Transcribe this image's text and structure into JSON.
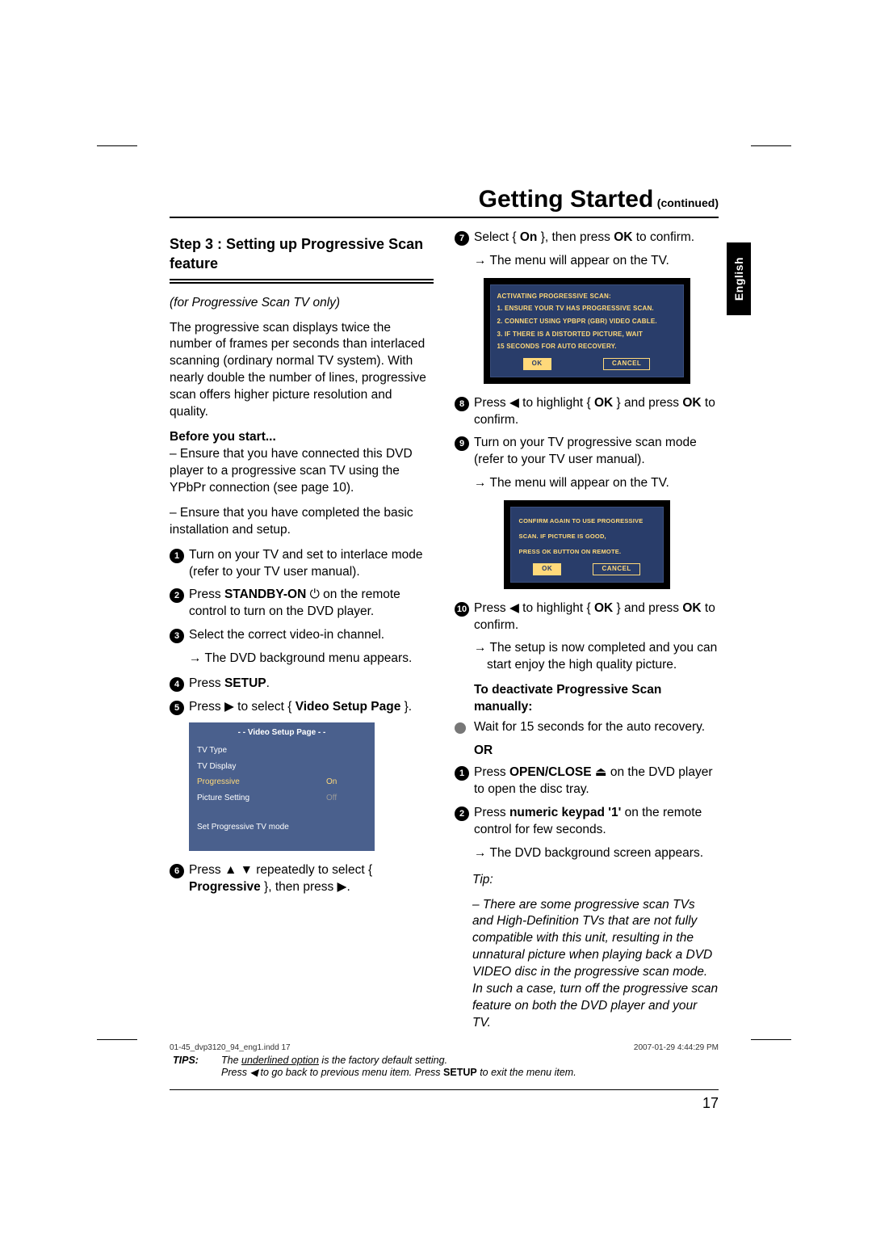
{
  "heading": {
    "title": "Getting Started",
    "continued": "(continued)"
  },
  "lang_tab": "English",
  "subhead": "Step 3 : Setting up Progressive Scan feature",
  "left": {
    "note": "(for Progressive Scan TV only)",
    "intro": "The progressive scan displays twice the number of frames per seconds than interlaced scanning (ordinary normal TV system). With nearly double the number of lines, progressive scan offers higher picture resolution and quality.",
    "before_head": "Before you start...",
    "before_1": "– Ensure that you have connected this DVD player to a progressive scan TV using the YPbPr connection (see page 10).",
    "before_2": "– Ensure that you have completed the basic installation and setup.",
    "s1": "Turn on your TV and set to interlace mode (refer to your TV user manual).",
    "s2_a": "Press ",
    "s2_b": "STANDBY-ON",
    "s2_icon": "⏻",
    "s2_c": " on the remote control to turn on the DVD player.",
    "s3": "Select the correct video-in channel.",
    "s3_arrow": "The DVD background menu appears.",
    "s4_a": "Press ",
    "s4_b": "SETUP",
    "s4_c": ".",
    "s5_a": "Press ",
    "s5_glyph": "▶",
    "s5_b": " to select { ",
    "s5_c": "Video Setup Page",
    "s5_d": " }.",
    "s6_a": "Press ",
    "s6_glyph1": "▲",
    "s6_glyph2": "▼",
    "s6_b": " repeatedly to select { ",
    "s6_c": "Progressive",
    "s6_d": " }, then press ",
    "s6_glyph3": "▶",
    "s6_e": "."
  },
  "osd": {
    "title": "- -   Video Setup Page   - -",
    "r1": "TV Type",
    "r2": "TV Display",
    "r3": "Progressive",
    "r3v": "On",
    "r4": "Picture Setting",
    "r4v": "Off",
    "footer": "Set Progressive TV mode"
  },
  "right": {
    "s7_a": "Select { ",
    "s7_b": "On",
    "s7_c": " }, then press ",
    "s7_d": "OK",
    "s7_e": " to confirm.",
    "s7_arrow": "The menu will appear on the TV.",
    "s8_a": "Press ",
    "s8_glyph": "◀",
    "s8_b": " to highlight { ",
    "s8_c": "OK",
    "s8_d": " } and press ",
    "s8_e": "OK",
    "s8_f": " to confirm.",
    "s9": "Turn on your TV progressive scan mode (refer to your TV user manual).",
    "s9_arrow": "The menu will appear on the TV.",
    "s10_a": "Press ",
    "s10_glyph": "◀",
    "s10_b": " to highlight { ",
    "s10_c": "OK",
    "s10_d": " } and press ",
    "s10_e": "OK",
    "s10_f": " to confirm.",
    "s10_arrow": "The setup is now completed and you can start enjoy the high quality picture.",
    "deact_head": "To deactivate Progressive Scan manually:",
    "deact_bullet": "Wait for 15 seconds for the auto recovery.",
    "or": "OR",
    "d1_a": "Press ",
    "d1_b": "OPEN/CLOSE",
    "d1_glyph": "⏏",
    "d1_c": " on the DVD player to open the disc tray.",
    "d2_a": "Press ",
    "d2_b": "numeric keypad '1'",
    "d2_c": " on the remote control for few seconds.",
    "d2_arrow": "The DVD background screen appears.",
    "tip_label": "Tip:",
    "tip_body": "– There are some progressive scan TVs and High-Definition TVs that are not fully compatible with this unit, resulting in the unnatural picture when playing back a DVD VIDEO disc in the progressive scan mode. In such a case, turn off the progressive scan feature on both the DVD player and your TV."
  },
  "dialog1": {
    "l1": "ACTIVATING PROGRESSIVE SCAN:",
    "l2": "1. ENSURE YOUR TV HAS PROGRESSIVE SCAN.",
    "l3": "2. CONNECT USING YPBPR (GBR) VIDEO CABLE.",
    "l4": "3. IF THERE IS A DISTORTED PICTURE, WAIT",
    "l5": "    15 SECONDS FOR AUTO RECOVERY.",
    "ok": "OK",
    "cancel": "CANCEL"
  },
  "dialog2": {
    "l1": "CONFIRM AGAIN TO USE PROGRESSIVE",
    "l2": "SCAN. IF PICTURE IS GOOD,",
    "l3": "PRESS OK BUTTON ON REMOTE.",
    "ok": "OK",
    "cancel": "CANCEL"
  },
  "tips": {
    "label": "TIPS:",
    "line1a": "The ",
    "line1b": "underlined option",
    "line1c": " is the factory default setting.",
    "line2a": "Press ",
    "line2glyph": "◀",
    "line2b": " to go back to previous menu item. Press ",
    "line2c": "SETUP",
    "line2d": " to exit the menu item."
  },
  "page_number": "17",
  "footer": {
    "left": "01-45_dvp3120_94_eng1.indd   17",
    "right": "2007-01-29   4:44:29 PM"
  }
}
